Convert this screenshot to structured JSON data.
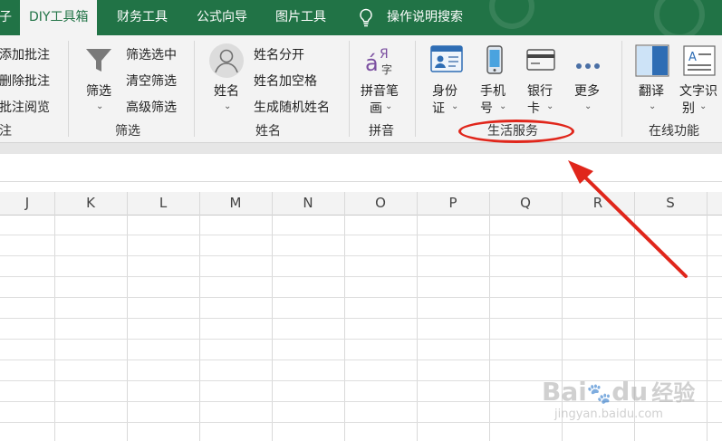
{
  "tabs": [
    "子",
    "DIY工具箱",
    "财务工具",
    "公式向导",
    "图片工具"
  ],
  "tell_me": "操作说明搜索",
  "groups": {
    "comments": {
      "items": [
        "添加批注",
        "删除批注",
        "批注阅览"
      ],
      "label": "注"
    },
    "filter": {
      "button": "筛选",
      "items": [
        "筛选选中",
        "清空筛选",
        "高级筛选"
      ],
      "label": "筛选"
    },
    "name": {
      "button": "姓名",
      "items": [
        "姓名分开",
        "姓名加空格",
        "生成随机姓名"
      ],
      "label": "姓名"
    },
    "pinyin": {
      "button_line1": "拼音笔",
      "button_line2": "画",
      "label": "拼音"
    },
    "life": {
      "idcard": {
        "line1": "身份",
        "line2": "证"
      },
      "phone": {
        "line1": "手机",
        "line2": "号"
      },
      "bankcard": {
        "line1": "银行",
        "line2": "卡"
      },
      "more": "更多",
      "label": "生活服务"
    },
    "online": {
      "translate": "翻译",
      "ocr_line1": "文字识",
      "ocr_line2": "别",
      "label": "在线功能"
    }
  },
  "columns": [
    "J",
    "K",
    "L",
    "M",
    "N",
    "O",
    "P",
    "Q",
    "R",
    "S"
  ],
  "watermark": {
    "line1": "Bai",
    "line2": "du",
    "line3": "经验",
    "line4": "jingyan.baidu.com"
  },
  "colors": {
    "accent": "#217346",
    "annotation": "#e0261b"
  }
}
